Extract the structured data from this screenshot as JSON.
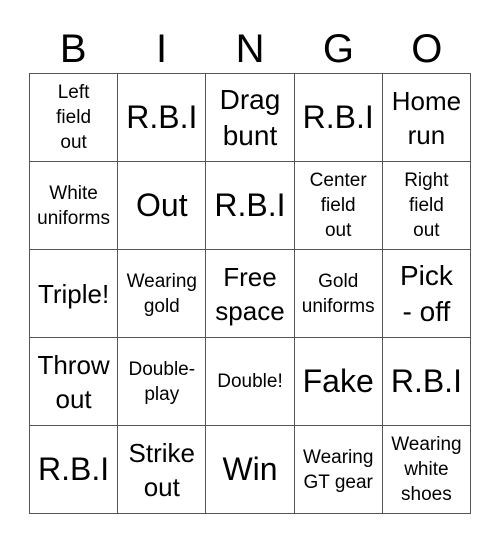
{
  "header": {
    "letters": [
      "B",
      "I",
      "N",
      "G",
      "O"
    ]
  },
  "grid": {
    "rows": [
      [
        {
          "text": "Left field out",
          "size": "s-xs"
        },
        {
          "text": "R.B.I",
          "size": "s-xl"
        },
        {
          "text": "Drag bunt",
          "size": "s-l"
        },
        {
          "text": "R.B.I",
          "size": "s-xl"
        },
        {
          "text": "Home run",
          "size": "s-m"
        }
      ],
      [
        {
          "text": "White uniforms",
          "size": "s-xs"
        },
        {
          "text": "Out",
          "size": "s-xl"
        },
        {
          "text": "R.B.I",
          "size": "s-xl"
        },
        {
          "text": "Center field out",
          "size": "s-xs"
        },
        {
          "text": "Right field out",
          "size": "s-xs"
        }
      ],
      [
        {
          "text": "Triple!",
          "size": "s-m"
        },
        {
          "text": "Wearing gold",
          "size": "s-xs"
        },
        {
          "text": "Free space",
          "size": "s-m"
        },
        {
          "text": "Gold uniforms",
          "size": "s-xs"
        },
        {
          "text": "Pick - off",
          "size": "s-l"
        }
      ],
      [
        {
          "text": "Throw out",
          "size": "s-m"
        },
        {
          "text": "Double-play",
          "size": "s-xs"
        },
        {
          "text": "Double!",
          "size": "s-xs"
        },
        {
          "text": "Fake",
          "size": "s-xl"
        },
        {
          "text": "R.B.I",
          "size": "s-xl"
        }
      ],
      [
        {
          "text": "R.B.I",
          "size": "s-xl"
        },
        {
          "text": "Strike out",
          "size": "s-m"
        },
        {
          "text": "Win",
          "size": "s-xl"
        },
        {
          "text": "Wearing GT gear",
          "size": "s-xs"
        },
        {
          "text": "Wearing white shoes",
          "size": "s-xs"
        }
      ]
    ]
  }
}
